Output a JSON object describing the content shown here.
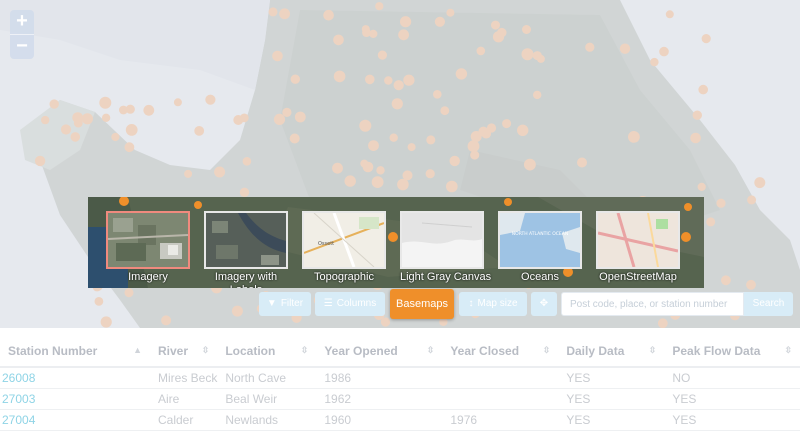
{
  "map": {
    "zoom_in_label": "+",
    "zoom_out_label": "−",
    "colors": {
      "station_dot": "#f7b98a",
      "land": "#c9ccd0",
      "sea": "#e6e9ee"
    }
  },
  "basemaps": {
    "items": [
      {
        "label": "Imagery",
        "selected": true
      },
      {
        "label": "Imagery with Labels",
        "selected": false
      },
      {
        "label": "Topographic",
        "selected": false
      },
      {
        "label": "Light Gray Canvas",
        "selected": false
      },
      {
        "label": "Oceans",
        "selected": false
      },
      {
        "label": "OpenStreetMap",
        "selected": false
      }
    ],
    "thumb_text": {
      "ocean": "NORTH ATLANTIC OCEAN",
      "topo": "Ossett"
    }
  },
  "toolbar": {
    "filter_label": "Filter",
    "columns_label": "Columns",
    "basemaps_label": "Basemaps",
    "map_size_label": "Map size",
    "locate_label": "",
    "search_placeholder": "Post code, place, or station number",
    "search_button_label": "Search",
    "colors": {
      "active": "#ef8f2a",
      "light": "#d8ecf7"
    }
  },
  "table": {
    "columns": [
      "Station Number",
      "River",
      "Location",
      "Year Opened",
      "Year Closed",
      "Daily Data",
      "Peak Flow Data"
    ],
    "rows": [
      [
        "26008",
        "Mires Beck",
        "North Cave",
        "1986",
        "",
        "YES",
        "NO"
      ],
      [
        "27003",
        "Aire",
        "Beal Weir",
        "1962",
        "",
        "YES",
        "YES"
      ],
      [
        "27004",
        "Calder",
        "Newlands",
        "1960",
        "1976",
        "YES",
        "YES"
      ]
    ]
  }
}
